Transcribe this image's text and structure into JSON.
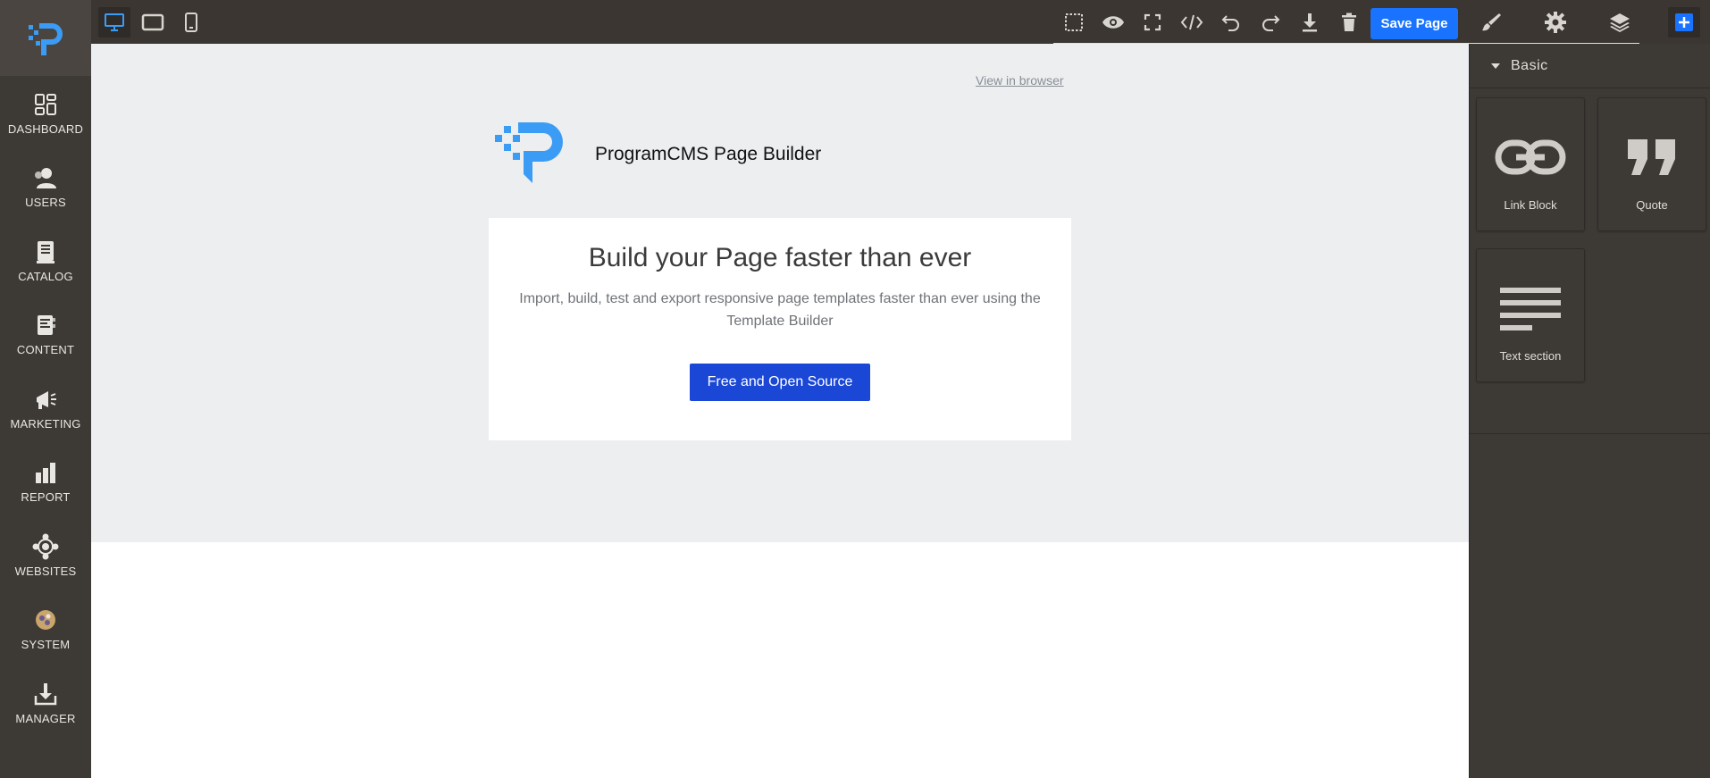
{
  "sidebar": {
    "items": [
      {
        "label": "DASHBOARD",
        "icon": "dashboard-icon"
      },
      {
        "label": "USERS",
        "icon": "users-icon"
      },
      {
        "label": "CATALOG",
        "icon": "catalog-icon"
      },
      {
        "label": "CONTENT",
        "icon": "content-icon"
      },
      {
        "label": "MARKETING",
        "icon": "marketing-icon"
      },
      {
        "label": "REPORT",
        "icon": "report-icon"
      },
      {
        "label": "WEBSITES",
        "icon": "websites-icon"
      },
      {
        "label": "SYSTEM",
        "icon": "system-icon"
      },
      {
        "label": "MANAGER",
        "icon": "manager-icon"
      }
    ]
  },
  "toolbar": {
    "devices": [
      "desktop-icon",
      "tablet-icon",
      "mobile-icon"
    ],
    "actions": [
      "sw-visibility-icon",
      "preview-icon",
      "fullscreen-icon",
      "code-icon",
      "undo-icon",
      "redo-icon",
      "download-icon",
      "trash-icon"
    ],
    "save_label": "Save Page",
    "panels": [
      "brush-icon",
      "gear-icon",
      "layers-icon",
      "blocks-icon"
    ]
  },
  "canvas": {
    "view_in_browser": "View in browser",
    "brand_name": "ProgramCMS Page Builder",
    "hero": {
      "title": "Build your Page faster than ever",
      "subtitle": "Import, build, test and export responsive page templates faster than ever using the Template Builder",
      "cta": "Free and Open Source"
    }
  },
  "panel": {
    "category": "Basic",
    "blocks": [
      {
        "label": "Link Block",
        "icon": "link-icon"
      },
      {
        "label": "Quote",
        "icon": "quote-icon"
      },
      {
        "label": "Text section",
        "icon": "text-section-icon"
      }
    ]
  },
  "colors": {
    "sidebar_bg": "#3d3935",
    "accent_blue": "#1a73ff",
    "cta_blue": "#1a47d6",
    "logo_blue": "#3b9cf5",
    "canvas_bg": "#eceef0"
  }
}
